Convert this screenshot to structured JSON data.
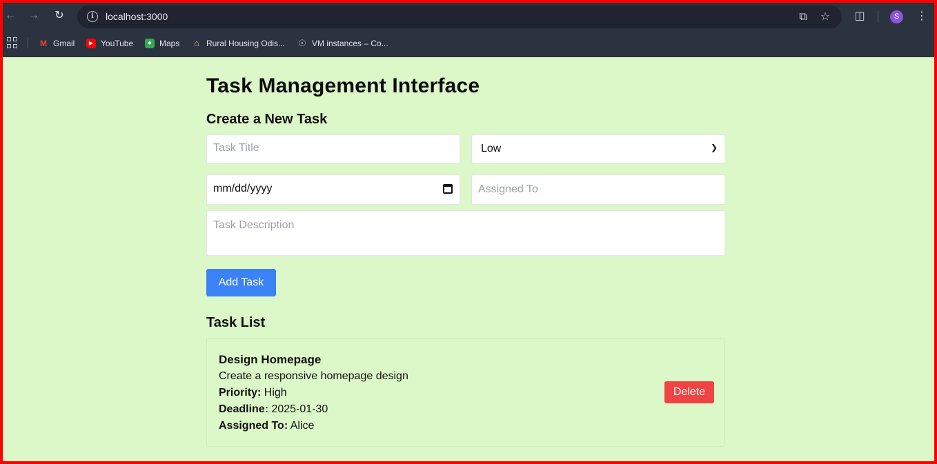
{
  "browser": {
    "url": "localhost:3000",
    "profile_initial": "S",
    "bookmarks": [
      {
        "label": "Gmail",
        "icon": "gmail-icon"
      },
      {
        "label": "YouTube",
        "icon": "youtube-icon"
      },
      {
        "label": "Maps",
        "icon": "maps-icon"
      },
      {
        "label": "Rural Housing Odis...",
        "icon": "house-icon"
      },
      {
        "label": "VM instances – Co...",
        "icon": "globe-icon"
      }
    ]
  },
  "page": {
    "title": "Task Management Interface",
    "create_heading": "Create a New Task",
    "form": {
      "title_placeholder": "Task Title",
      "priority_value": "Low",
      "date_placeholder": "mm/dd/yyyy",
      "assigned_placeholder": "Assigned To",
      "description_placeholder": "Task Description",
      "add_label": "Add Task"
    },
    "list_heading": "Task List",
    "tasks": [
      {
        "name": "Design Homepage",
        "description": "Create a responsive homepage design",
        "priority_label": "Priority:",
        "priority": "High",
        "deadline_label": "Deadline:",
        "deadline": "2025-01-30",
        "assigned_label": "Assigned To:",
        "assigned": "Alice",
        "delete_label": "Delete"
      }
    ]
  },
  "colors": {
    "page_bg": "#dcf7c8",
    "add_button": "#3b82f6",
    "delete_button": "#ef4444",
    "frame_border": "#ff0000"
  }
}
